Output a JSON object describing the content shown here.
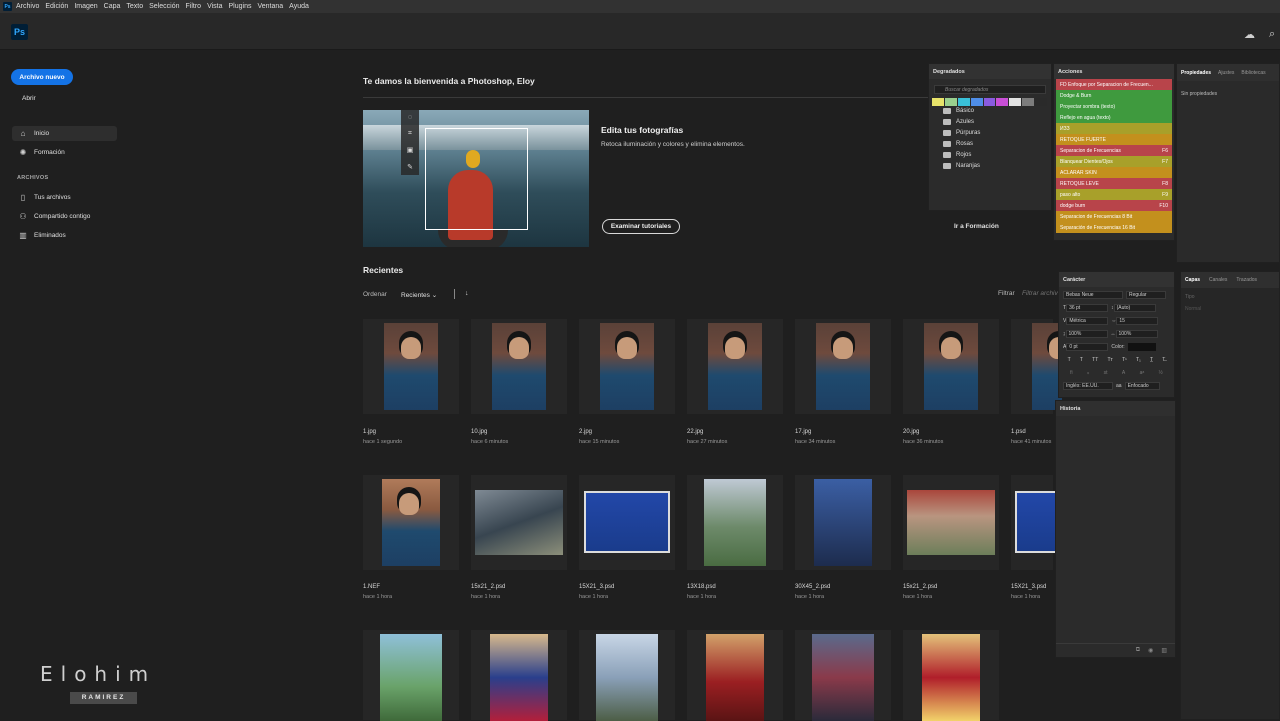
{
  "menubar": {
    "app_icon": "Ps",
    "items": [
      "Archivo",
      "Edición",
      "Imagen",
      "Capa",
      "Texto",
      "Selección",
      "Filtro",
      "Vista",
      "Plugins",
      "Ventana",
      "Ayuda"
    ]
  },
  "toolbar": {
    "logo": "Ps",
    "cloud_icon": "cloud-icon",
    "search_icon": "search-icon"
  },
  "leftnav": {
    "new_file": "Archivo nuevo",
    "open": "Abrir",
    "items": [
      {
        "label": "Inicio",
        "icon": "home-icon"
      },
      {
        "label": "Formación",
        "icon": "lightbulb-icon"
      }
    ],
    "section_files": "ARCHIVOS",
    "file_items": [
      {
        "label": "Tus archivos",
        "icon": "file-icon"
      },
      {
        "label": "Compartido contigo",
        "icon": "share-icon"
      },
      {
        "label": "Eliminados",
        "icon": "trash-icon"
      }
    ]
  },
  "watermark": {
    "name": "Elohim",
    "sub": "RAMIREZ"
  },
  "home": {
    "welcome": "Te damos la bienvenida a Photoshop, Eloy",
    "hero_title": "Edita tus fotografías",
    "hero_desc": "Retoca iluminación y colores y elimina elementos.",
    "hero_button": "Examinar tutoriales",
    "ir_formacion": "Ir a Formación"
  },
  "recent": {
    "title": "Recientes",
    "sort_label": "Ordenar",
    "sort_value": "Recientes",
    "filter_label": "Filtrar",
    "filter_placeholder": "Filtrar archivos",
    "files": [
      {
        "name": "1.jpg",
        "time": "hace 1 segundo"
      },
      {
        "name": "10.jpg",
        "time": "hace 6 minutos"
      },
      {
        "name": "2.jpg",
        "time": "hace 15 minutos"
      },
      {
        "name": "22.jpg",
        "time": "hace 27 minutos"
      },
      {
        "name": "17.jpg",
        "time": "hace 34 minutos"
      },
      {
        "name": "20.jpg",
        "time": "hace 36 minutos"
      },
      {
        "name": "1.psd",
        "time": "hace 41 minutos"
      },
      {
        "name": "1.NEF",
        "time": "hace 1 hora"
      },
      {
        "name": "15x21_2.psd",
        "time": "hace 1 hora"
      },
      {
        "name": "15X21_3.psd",
        "time": "hace 1 hora"
      },
      {
        "name": "13X18.psd",
        "time": "hace 1 hora"
      },
      {
        "name": "30X45_2.psd",
        "time": "hace 1 hora"
      },
      {
        "name": "15x21_2.psd",
        "time": "hace 1 hora"
      },
      {
        "name": "15X21_3.psd",
        "time": "hace 1 hora"
      }
    ]
  },
  "panels": {
    "gradients": {
      "title": "Degradados",
      "search_placeholder": "Buscar degradados",
      "folders": [
        "Básico",
        "Azules",
        "Púrpuras",
        "Rosas",
        "Rojos",
        "Naranjas"
      ],
      "swatch_colors": [
        "#e8e36a",
        "#9ad08e",
        "#39c0d8",
        "#4f8ee8",
        "#8a5be0",
        "#c94fd6",
        "#e2e2e2",
        "#7c7c7c",
        "#2a2a2a"
      ]
    },
    "actions": {
      "title": "Acciones",
      "items": [
        {
          "label": "FD Enfoque por Separacion de Frecuen...",
          "key": "",
          "color": "#b8444a"
        },
        {
          "label": "Dodge & Burn",
          "key": "",
          "color": "#3f9a3e"
        },
        {
          "label": "Proyectar sombra (texto)",
          "key": "",
          "color": "#3f9a3e"
        },
        {
          "label": "Reflejo en agua (texto)",
          "key": "",
          "color": "#3f9a3e"
        },
        {
          "label": "ИЗЗ",
          "key": "",
          "color": "#a8a02a"
        },
        {
          "label": "RETOQUE FUERTE",
          "key": "",
          "color": "#c3901d"
        },
        {
          "label": "Separacion de Frecuencias",
          "key": "F6",
          "color": "#b8444a"
        },
        {
          "label": "Blanquear Dientes/Ojos",
          "key": "F7",
          "color": "#a8a02a"
        },
        {
          "label": "ACLARAR SKIN",
          "key": "",
          "color": "#c3901d"
        },
        {
          "label": "RETOQUE LEVE",
          "key": "F8",
          "color": "#b8444a"
        },
        {
          "label": "paso alto",
          "key": "F9",
          "color": "#a8a02a"
        },
        {
          "label": "dodge burn",
          "key": "F10",
          "color": "#b8444a"
        },
        {
          "label": "Separacion de Frecuencias 8 Bit",
          "key": "",
          "color": "#c3901d"
        },
        {
          "label": "Separación de Frecuencias 16 Bit",
          "key": "",
          "color": "#c3901d"
        }
      ]
    },
    "properties": {
      "tabs": [
        "Propiedades",
        "Ajustes",
        "Bibliotecas"
      ],
      "empty": "Sin propiedades"
    },
    "character": {
      "title": "Carácter",
      "font": "Bebas Neue",
      "style": "Regular",
      "size": "36 pt",
      "leading": "(Auto)",
      "kerning": "Métrica",
      "tracking": "15",
      "vscale": "100%",
      "hscale": "100%",
      "baseline": "0 pt",
      "color_label": "Color:",
      "language": "Inglés: EE.UU.",
      "aa": "Enfocado"
    },
    "layers": {
      "tabs": [
        "Capas",
        "Canales",
        "Trazados"
      ],
      "kind": "Tipo",
      "blend": "Normal"
    },
    "history": {
      "title": "Historia"
    }
  }
}
